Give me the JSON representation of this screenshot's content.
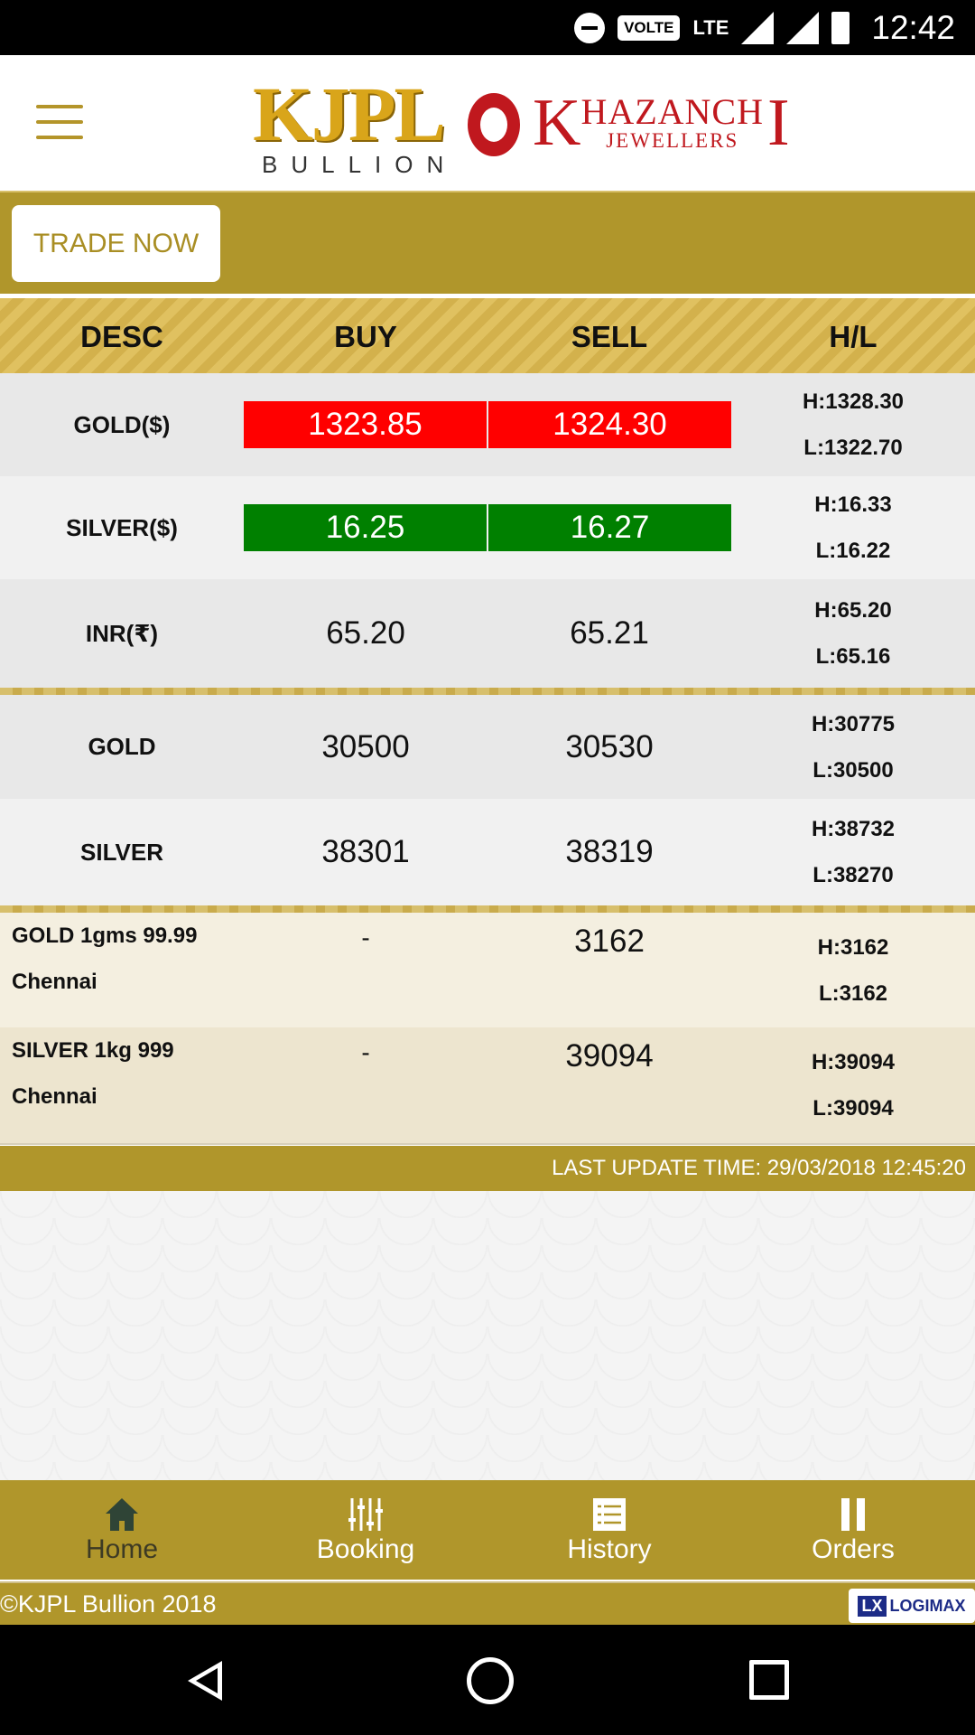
{
  "status_bar": {
    "time": "12:42",
    "volte": "VOLTE",
    "network": "LTE"
  },
  "header": {
    "logo_kjpl_main": "KJPL",
    "logo_kjpl_sub": "BULLION",
    "logo_khazanchi_k": "K",
    "logo_khazanchi_main": "HAZANCH",
    "logo_khazanchi_i": "I",
    "logo_khazanchi_sub": "JEWELLERS"
  },
  "trade_button": "TRADE NOW",
  "table": {
    "headers": [
      "DESC",
      "BUY",
      "SELL",
      "H/L"
    ],
    "intl_rows": [
      {
        "desc": "GOLD($)",
        "buy": "1323.85",
        "sell": "1324.30",
        "high": "H:1328.30",
        "low": "L:1322.70",
        "color": "#ff0000"
      },
      {
        "desc": "SILVER($)",
        "buy": "16.25",
        "sell": "16.27",
        "high": "H:16.33",
        "low": "L:16.22",
        "color": "#008000"
      },
      {
        "desc": "INR(₹)",
        "buy": "65.20",
        "sell": "65.21",
        "high": "H:65.20",
        "low": "L:65.16"
      }
    ],
    "local_rows": [
      {
        "desc": "GOLD",
        "buy": "30500",
        "sell": "30530",
        "high": "H:30775",
        "low": "L:30500"
      },
      {
        "desc": "SILVER",
        "buy": "38301",
        "sell": "38319",
        "high": "H:38732",
        "low": "L:38270"
      }
    ],
    "retail_rows": [
      {
        "desc_line1": "GOLD 1gms 99.99",
        "desc_line2": "Chennai",
        "buy": "-",
        "sell": "3162",
        "high": "H:3162",
        "low": "L:3162"
      },
      {
        "desc_line1": "SILVER 1kg 999",
        "desc_line2": "Chennai",
        "buy": "-",
        "sell": "39094",
        "high": "H:39094",
        "low": "L:39094"
      }
    ]
  },
  "last_update": "LAST UPDATE TIME: 29/03/2018 12:45:20",
  "bottom_nav": [
    {
      "label": "Home",
      "icon": "home-icon",
      "active": true
    },
    {
      "label": "Booking",
      "icon": "sliders-icon"
    },
    {
      "label": "History",
      "icon": "list-icon"
    },
    {
      "label": "Orders",
      "icon": "pause-icon"
    }
  ],
  "footer": {
    "copyright": "©KJPL Bullion 2018",
    "brand_mark": "LX",
    "brand": "LOGIMAX"
  },
  "colors": {
    "gold_bar": "#b0962b",
    "sell_up": "#008000",
    "sell_down": "#ff0000"
  }
}
